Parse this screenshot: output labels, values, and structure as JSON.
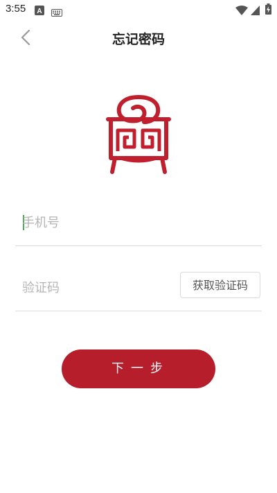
{
  "status_bar": {
    "time": "3:55",
    "icons": [
      "notification-a-icon",
      "keyboard-icon",
      "wifi-icon",
      "signal-icon",
      "battery-charging-icon"
    ]
  },
  "header": {
    "title": "忘记密码",
    "back_icon": "chevron-left-icon"
  },
  "logo": {
    "name": "red-seal-logo",
    "color": "#c0202e"
  },
  "form": {
    "phone_placeholder": "手机号",
    "phone_value": "",
    "code_placeholder": "验证码",
    "code_value": "",
    "get_code_label": "获取验证码"
  },
  "actions": {
    "next_label": "下一步"
  },
  "colors": {
    "accent": "#b61e2c",
    "cursor": "#4caf50",
    "divider": "#dcdcdc"
  }
}
